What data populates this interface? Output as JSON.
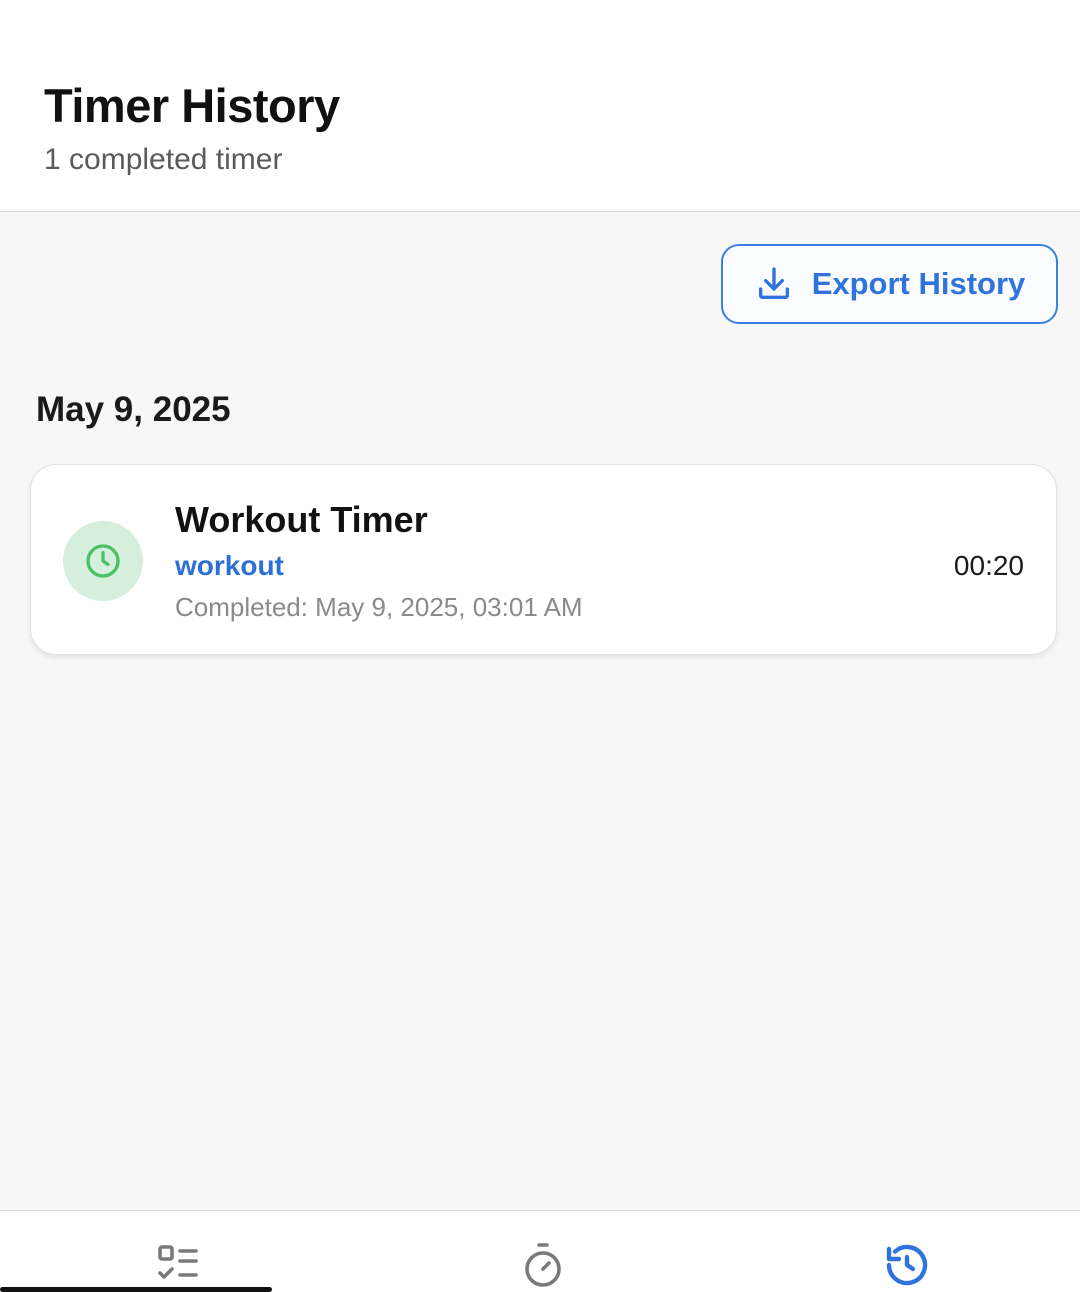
{
  "header": {
    "title": "Timer History",
    "subtitle": "1 completed timer"
  },
  "toolbar": {
    "export_label": "Export History",
    "export_icon": "download-icon"
  },
  "history": {
    "groups": [
      {
        "date": "May 9, 2025",
        "entries": [
          {
            "title": "Workout Timer",
            "category": "workout",
            "completed": "Completed: May 9, 2025, 03:01 AM",
            "duration": "00:20",
            "icon": "clock-icon"
          }
        ]
      }
    ]
  },
  "tabbar": {
    "tabs": [
      {
        "name": "tasks",
        "icon": "checklist-icon",
        "active": false
      },
      {
        "name": "timer",
        "icon": "stopwatch-icon",
        "active": false
      },
      {
        "name": "history",
        "icon": "history-icon",
        "active": true
      }
    ]
  },
  "colors": {
    "accent": "#2f74dd",
    "icon_bg": "#d6efdc",
    "icon_fg": "#4cbf63",
    "inactive_tab": "#7a7a7a"
  }
}
